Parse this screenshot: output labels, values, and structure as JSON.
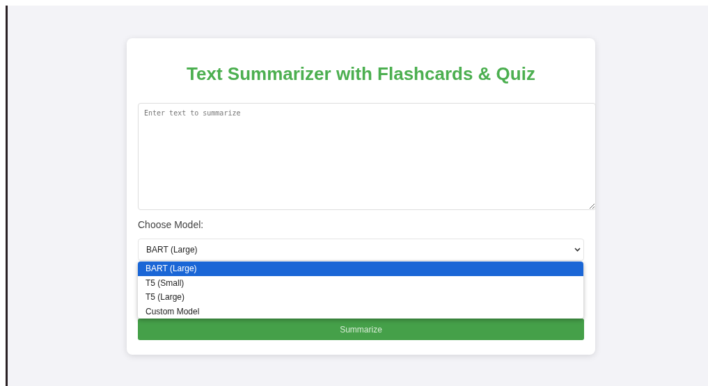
{
  "title": "Text Summarizer with Flashcards & Quiz",
  "text_input": {
    "placeholder": "Enter text to summarize"
  },
  "model_label": "Choose Model:",
  "model_select": {
    "value": "BART (Large)",
    "expanded": true,
    "options": [
      {
        "label": "BART (Large)",
        "selected": true
      },
      {
        "label": "T5 (Small)",
        "selected": false
      },
      {
        "label": "T5 (Large)",
        "selected": false
      },
      {
        "label": "Custom Model",
        "selected": false
      }
    ]
  },
  "submit_button": "Summarize"
}
